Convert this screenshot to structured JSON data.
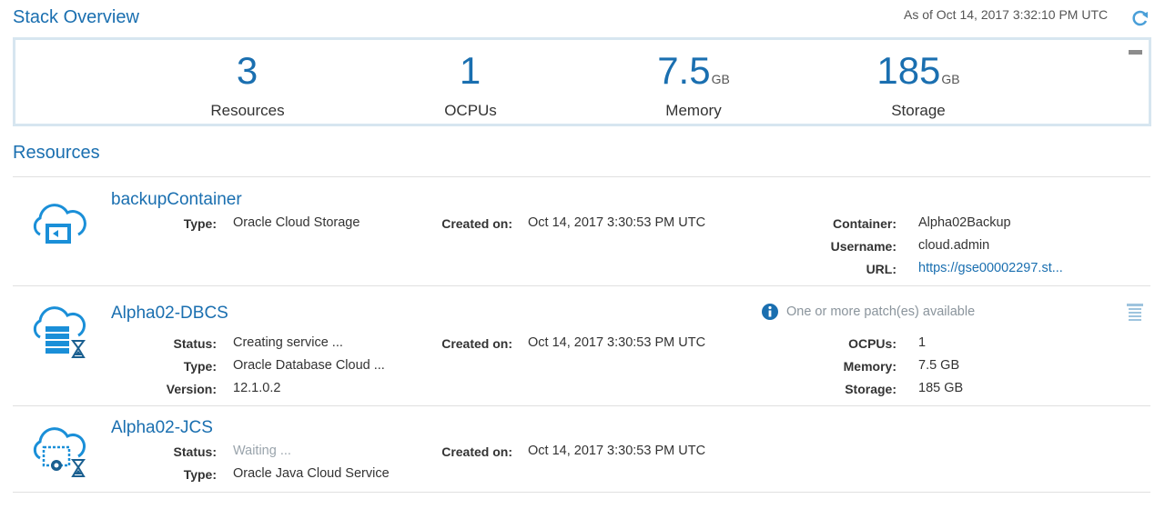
{
  "overview": {
    "title": "Stack Overview",
    "as_of": "As of Oct 14, 2017 3:32:10 PM UTC",
    "stats": [
      {
        "value": "3",
        "unit": "",
        "label": "Resources"
      },
      {
        "value": "1",
        "unit": "",
        "label": "OCPUs"
      },
      {
        "value": "7.5",
        "unit": "GB",
        "label": "Memory"
      },
      {
        "value": "185",
        "unit": "GB",
        "label": "Storage"
      }
    ]
  },
  "resources": {
    "title": "Resources",
    "items": [
      {
        "name": "backupContainer",
        "icon": "cloud-storage-icon",
        "type_label": "Type:",
        "type_value": "Oracle Cloud Storage",
        "created_label": "Created on:",
        "created_value": "Oct 14, 2017 3:30:53 PM UTC",
        "container_label": "Container:",
        "container_value": "Alpha02Backup",
        "username_label": "Username:",
        "username_value": "cloud.admin",
        "url_label": "URL:",
        "url_value": "https://gse00002297.st..."
      },
      {
        "name": "Alpha02-DBCS",
        "icon": "cloud-database-icon",
        "patch_notice": "One or more patch(es) available",
        "status_label": "Status:",
        "status_value": "Creating service ...",
        "type_label": "Type:",
        "type_value": "Oracle Database Cloud ...",
        "version_label": "Version:",
        "version_value": "12.1.0.2",
        "created_label": "Created on:",
        "created_value": "Oct 14, 2017 3:30:53 PM UTC",
        "ocpus_label": "OCPUs:",
        "ocpus_value": "1",
        "memory_label": "Memory:",
        "memory_value": "7.5 GB",
        "storage_label": "Storage:",
        "storage_value": "185 GB"
      },
      {
        "name": "Alpha02-JCS",
        "icon": "cloud-java-icon",
        "status_label": "Status:",
        "status_value": "Waiting ...",
        "type_label": "Type:",
        "type_value": "Oracle Java Cloud Service",
        "created_label": "Created on:",
        "created_value": "Oct 14, 2017 3:30:53 PM UTC"
      }
    ]
  },
  "colors": {
    "accent": "#1a6fb0",
    "panel_border": "#d7e6f0",
    "divider": "#e0e0e0"
  }
}
